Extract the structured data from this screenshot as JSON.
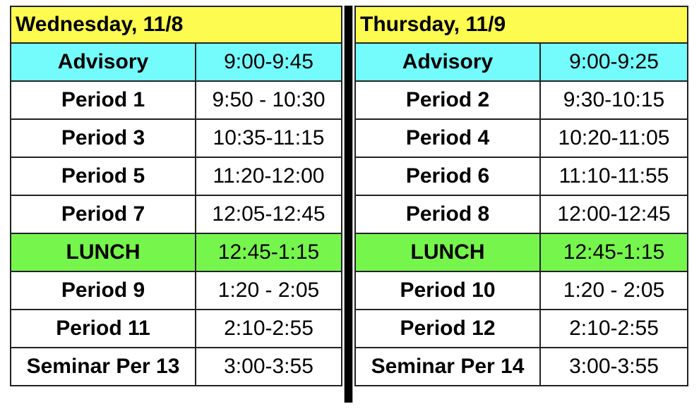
{
  "colors": {
    "header": "#fdfb4f",
    "advisory": "#74fbfc",
    "lunch": "#76f64c",
    "regular": "#ffffff",
    "divider": "#000000"
  },
  "days": [
    {
      "title": "Wednesday, 11/8",
      "rows": [
        {
          "type": "advisory",
          "name": "Advisory",
          "time": "9:00-9:45"
        },
        {
          "type": "normal",
          "name": "Period 1",
          "time": "9:50 - 10:30"
        },
        {
          "type": "normal",
          "name": "Period 3",
          "time": "10:35-11:15"
        },
        {
          "type": "normal",
          "name": "Period 5",
          "time": "11:20-12:00"
        },
        {
          "type": "normal",
          "name": "Period 7",
          "time": "12:05-12:45"
        },
        {
          "type": "lunch",
          "name": "LUNCH",
          "time": "12:45-1:15"
        },
        {
          "type": "normal",
          "name": "Period 9",
          "time": "1:20 - 2:05"
        },
        {
          "type": "normal",
          "name": "Period 11",
          "time": "2:10-2:55"
        },
        {
          "type": "normal",
          "name": "Seminar Per 13",
          "time": "3:00-3:55"
        }
      ]
    },
    {
      "title": "Thursday, 11/9",
      "rows": [
        {
          "type": "advisory",
          "name": "Advisory",
          "time": "9:00-9:25"
        },
        {
          "type": "normal",
          "name": "Period 2",
          "time": "9:30-10:15"
        },
        {
          "type": "normal",
          "name": "Period 4",
          "time": "10:20-11:05"
        },
        {
          "type": "normal",
          "name": "Period 6",
          "time": "11:10-11:55"
        },
        {
          "type": "normal",
          "name": "Period 8",
          "time": "12:00-12:45"
        },
        {
          "type": "lunch",
          "name": "LUNCH",
          "time": "12:45-1:15"
        },
        {
          "type": "normal",
          "name": "Period 10",
          "time": "1:20 - 2:05"
        },
        {
          "type": "normal",
          "name": "Period 12",
          "time": "2:10-2:55"
        },
        {
          "type": "normal",
          "name": "Seminar Per 14",
          "time": "3:00-3:55"
        }
      ]
    }
  ]
}
